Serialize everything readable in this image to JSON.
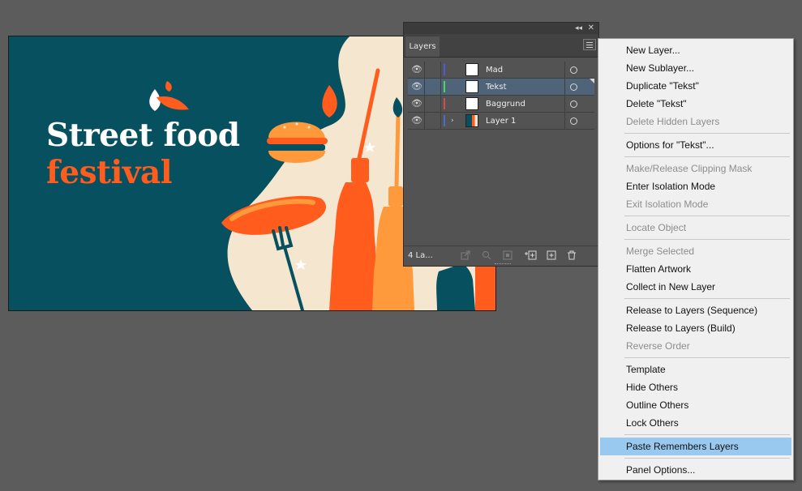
{
  "artboard": {
    "headline": "Street food",
    "subline": "festival",
    "colors": {
      "background": "#06505f",
      "cream": "#f5e6cf",
      "orange": "#ff5c1e",
      "light_orange": "#ff9a3c",
      "white": "#ffffff"
    }
  },
  "layers_panel": {
    "tab_label": "Layers",
    "layers": [
      {
        "name": "Mad",
        "color": "#4a5cd6",
        "selected": false,
        "expandable": false
      },
      {
        "name": "Tekst",
        "color": "#4ed65a",
        "selected": true,
        "expandable": false
      },
      {
        "name": "Baggrund",
        "color": "#d64a4a",
        "selected": false,
        "expandable": false
      },
      {
        "name": "Layer 1",
        "color": "#4a6ad6",
        "selected": false,
        "expandable": true
      }
    ],
    "layer_count": "4 La...",
    "icons": [
      "collapse-icon",
      "close-icon",
      "panel-menu-icon",
      "eye-icon",
      "export-icon",
      "search-icon",
      "clipping-mask-icon",
      "new-sublayer-icon",
      "new-layer-icon",
      "trash-icon"
    ]
  },
  "context_menu": {
    "groups": [
      [
        {
          "label": "New Layer...",
          "enabled": true
        },
        {
          "label": "New Sublayer...",
          "enabled": true
        },
        {
          "label": "Duplicate \"Tekst\"",
          "enabled": true
        },
        {
          "label": "Delete \"Tekst\"",
          "enabled": true
        },
        {
          "label": "Delete Hidden Layers",
          "enabled": false
        }
      ],
      [
        {
          "label": "Options for \"Tekst\"...",
          "enabled": true
        }
      ],
      [
        {
          "label": "Make/Release Clipping Mask",
          "enabled": false
        },
        {
          "label": "Enter Isolation Mode",
          "enabled": true
        },
        {
          "label": "Exit Isolation Mode",
          "enabled": false
        }
      ],
      [
        {
          "label": "Locate Object",
          "enabled": false
        }
      ],
      [
        {
          "label": "Merge Selected",
          "enabled": false
        },
        {
          "label": "Flatten Artwork",
          "enabled": true
        },
        {
          "label": "Collect in New Layer",
          "enabled": true
        }
      ],
      [
        {
          "label": "Release to Layers (Sequence)",
          "enabled": true
        },
        {
          "label": "Release to Layers (Build)",
          "enabled": true
        },
        {
          "label": "Reverse Order",
          "enabled": false
        }
      ],
      [
        {
          "label": "Template",
          "enabled": true
        },
        {
          "label": "Hide Others",
          "enabled": true
        },
        {
          "label": "Outline Others",
          "enabled": true
        },
        {
          "label": "Lock Others",
          "enabled": true
        }
      ],
      [
        {
          "label": "Paste Remembers Layers",
          "enabled": true,
          "highlighted": true
        }
      ],
      [
        {
          "label": "Panel Options...",
          "enabled": true
        }
      ]
    ]
  }
}
